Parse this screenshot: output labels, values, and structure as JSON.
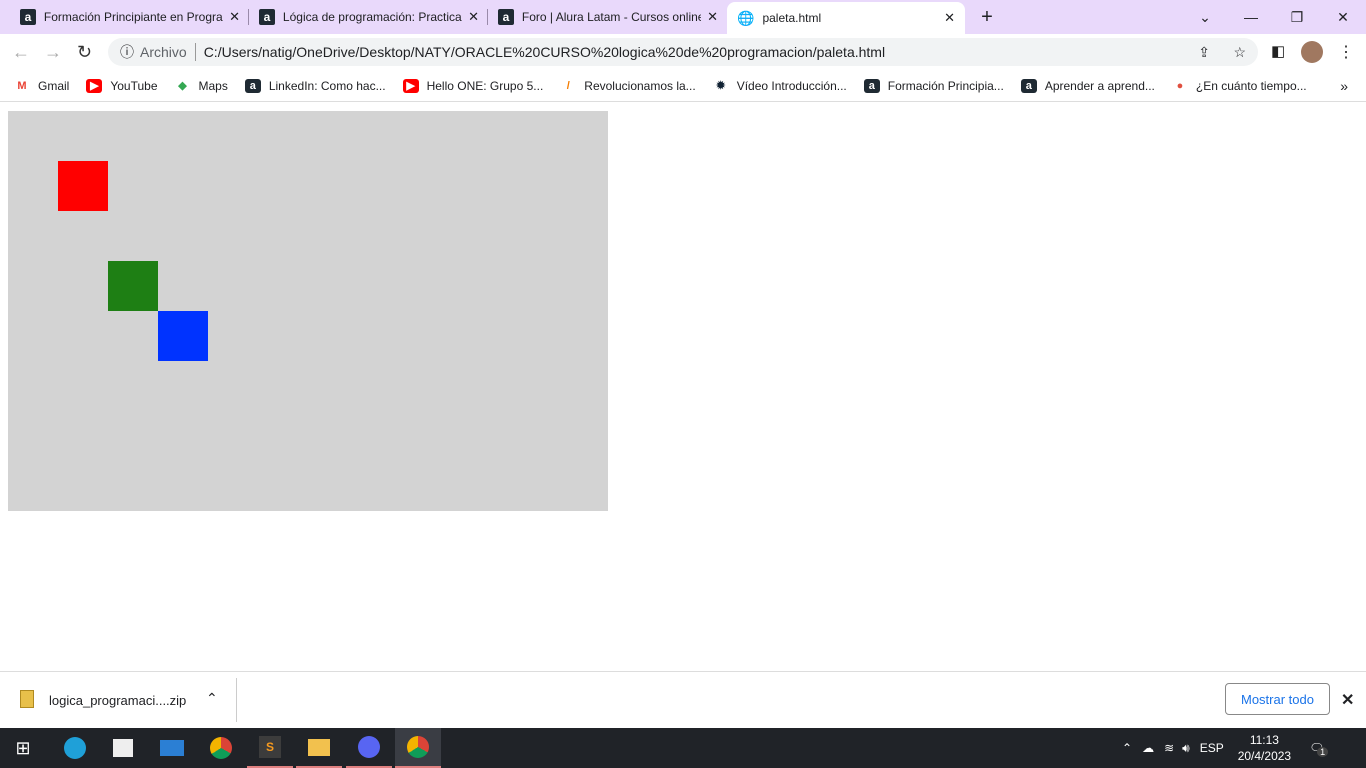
{
  "tabs": [
    {
      "title": "Formación Principiante en Progra",
      "icon": "alura-icon"
    },
    {
      "title": "Lógica de programación: Practica",
      "icon": "alura-icon"
    },
    {
      "title": "Foro | Alura Latam - Cursos online",
      "icon": "alura-icon"
    },
    {
      "title": "paleta.html",
      "icon": "globe-icon",
      "active": true
    }
  ],
  "address": {
    "scheme_label": "Archivo",
    "url": "C:/Users/natig/OneDrive/Desktop/NATY/ORACLE%20CURSO%20logica%20de%20programacion/paleta.html"
  },
  "bookmarks": [
    {
      "label": "Gmail",
      "icon": "gmail-icon"
    },
    {
      "label": "YouTube",
      "icon": "youtube-icon"
    },
    {
      "label": "Maps",
      "icon": "maps-icon"
    },
    {
      "label": "LinkedIn: Como hac...",
      "icon": "alura-icon"
    },
    {
      "label": "Hello ONE: Grupo 5...",
      "icon": "youtube-icon"
    },
    {
      "label": "Revolucionamos la...",
      "icon": "pencil-icon"
    },
    {
      "label": "Vídeo Introducción...",
      "icon": "gear-icon"
    },
    {
      "label": "Formación Principia...",
      "icon": "alura-icon"
    },
    {
      "label": "Aprender a aprend...",
      "icon": "alura-icon"
    },
    {
      "label": "¿En cuánto tiempo...",
      "icon": "brain-icon"
    }
  ],
  "canvas": {
    "background": "#d3d3d3",
    "squares": [
      {
        "color": "#ff0000"
      },
      {
        "color": "#1e7f14"
      },
      {
        "color": "#0033ff"
      }
    ]
  },
  "download": {
    "filename": "logica_programaci....zip",
    "show_all": "Mostrar todo"
  },
  "tray": {
    "lang": "ESP",
    "time": "11:13",
    "date": "20/4/2023",
    "notifications": "1"
  }
}
